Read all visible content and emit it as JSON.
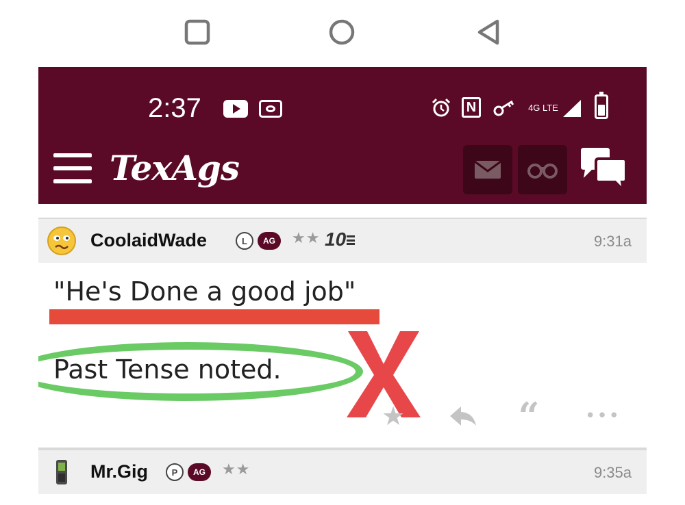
{
  "status_bar": {
    "time": "2:37",
    "network": "4G LTE"
  },
  "header": {
    "app_name": "TexAgs"
  },
  "posts": [
    {
      "username": "CoolaidWade",
      "badges": [
        "L",
        "AG"
      ],
      "stars": "★★",
      "rank": "10",
      "time": "9:31a",
      "lines": [
        "\"He's Done a good job\"",
        "Past Tense noted."
      ]
    },
    {
      "username": "Mr.Gig",
      "badges": [
        "P",
        "AG"
      ],
      "stars": "★★",
      "time": "9:35a"
    }
  ],
  "colors": {
    "header_bg": "#5a0a26",
    "annotation_red": "#e64a3a",
    "annotation_green": "#6acb65",
    "x_mark_red": "#e8474a"
  },
  "icons": [
    "square-nav-icon",
    "circle-nav-icon",
    "back-nav-icon",
    "youtube-icon",
    "cast-icon",
    "alarm-icon",
    "nfc-icon",
    "key-icon",
    "signal-icon",
    "battery-icon",
    "menu-icon",
    "mail-icon",
    "binoculars-icon",
    "chat-icon",
    "star-icon",
    "reply-icon",
    "quote-icon",
    "more-icon"
  ]
}
